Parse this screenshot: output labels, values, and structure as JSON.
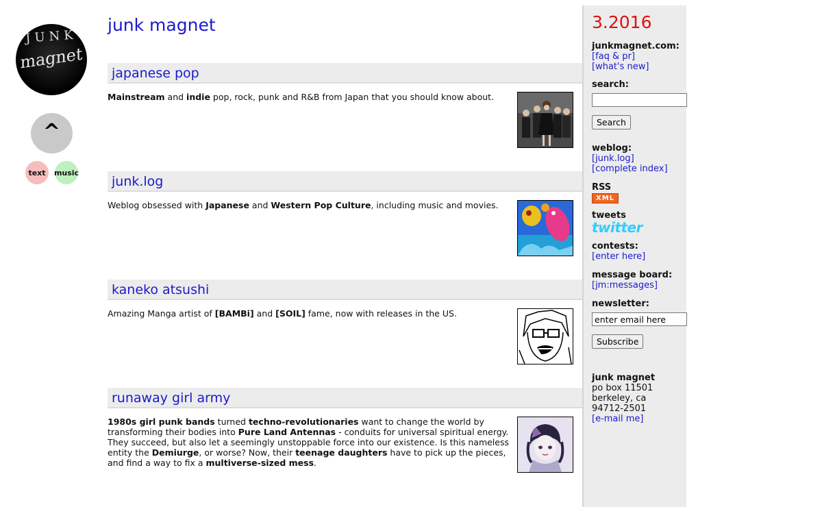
{
  "logo": {
    "line1": "JUNK",
    "line2": "magnet"
  },
  "nav": {
    "up_glyph": "^",
    "text_label": "text",
    "music_label": "music"
  },
  "site_title": "junk magnet",
  "sections": [
    {
      "title": "japanese pop",
      "parts": [
        {
          "b": "Mainstream"
        },
        {
          "t": " and "
        },
        {
          "b": "indie"
        },
        {
          "t": " pop, rock, punk and R&B from Japan that you should know about."
        }
      ]
    },
    {
      "title": "junk.log",
      "parts": [
        {
          "t": "Weblog obsessed with "
        },
        {
          "b": "Japanese"
        },
        {
          "t": " and "
        },
        {
          "b": "Western Pop Culture"
        },
        {
          "t": ", including music and movies."
        }
      ]
    },
    {
      "title": "kaneko atsushi",
      "parts": [
        {
          "t": "Amazing Manga artist of "
        },
        {
          "b": "[BAMBi]"
        },
        {
          "t": " and "
        },
        {
          "b": "[SOIL]"
        },
        {
          "t": " fame, now with releases in the US."
        }
      ]
    },
    {
      "title": "runaway girl army",
      "parts": [
        {
          "b": "1980s girl punk bands"
        },
        {
          "t": " turned "
        },
        {
          "b": "techno-revolutionaries"
        },
        {
          "t": " want to change the world by transforming their bodies into "
        },
        {
          "b": "Pure Land Antennas"
        },
        {
          "t": " - conduits for universal spiritual energy. They succeed, but also let a seemingly unstoppable force into our existence. Is this nameless entity the "
        },
        {
          "b": "Demiurge"
        },
        {
          "t": ", or worse? Now, their "
        },
        {
          "b": "teenage daughters"
        },
        {
          "t": " have to pick up the pieces, and find a way to fix a "
        },
        {
          "b": "multiverse-sized mess"
        },
        {
          "t": "."
        }
      ]
    }
  ],
  "sidebar": {
    "date": "3.2016",
    "site_heading": "junkmagnet.com:",
    "faq_link": "[faq & pr]",
    "whats_new_link": "[what's new]",
    "search_heading": "search:",
    "search_value": "",
    "search_button": "Search",
    "weblog_heading": "weblog:",
    "junklog_link": "[junk.log]",
    "index_link": "[complete index]",
    "rss_heading": "RSS",
    "xml_badge": "XML",
    "tweets_heading": "tweets",
    "twitter_logo": "twitter",
    "contests_heading": "contests:",
    "contests_link": "[enter here]",
    "board_heading": "message board:",
    "board_link": "[jm:messages]",
    "newsletter_heading": "newsletter:",
    "newsletter_value": "enter email here",
    "subscribe_button": "Subscribe",
    "address_name": "junk magnet",
    "address_line1": "po box 11501",
    "address_line2": "berkeley, ca",
    "address_line3": "94712-2501",
    "email_link": "[e-mail me]"
  },
  "colors": {
    "link": "#1a1acc",
    "date": "#e01010",
    "section_bar": "#ececec",
    "sidebar_bg": "#ececec"
  }
}
